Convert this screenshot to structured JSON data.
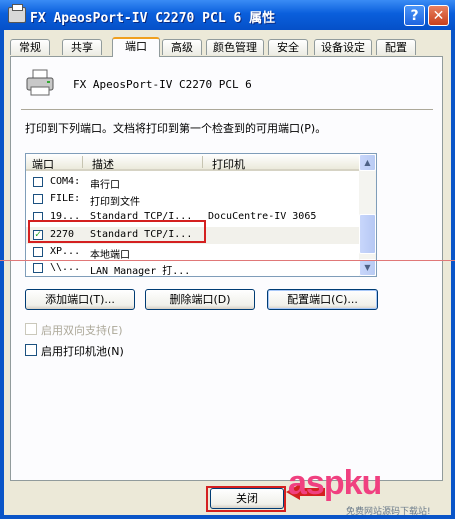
{
  "window": {
    "title": "FX ApeosPort-IV C2270 PCL 6 属性",
    "help_label": "?",
    "close_label": "✕"
  },
  "tabs": [
    {
      "label": "常规"
    },
    {
      "label": "共享"
    },
    {
      "label": "端口",
      "active": true
    },
    {
      "label": "高级"
    },
    {
      "label": "颜色管理"
    },
    {
      "label": "安全"
    },
    {
      "label": "设备设定"
    },
    {
      "label": "配置"
    }
  ],
  "printer_name": "FX ApeosPort-IV C2270 PCL 6",
  "instruction": "打印到下列端口。文档将打印到第一个检查到的可用端口(P)。",
  "port_list": {
    "columns": [
      "端口",
      "描述",
      "打印机"
    ],
    "rows": [
      {
        "checked": false,
        "port": "COM4:",
        "desc": "串行口",
        "printer": ""
      },
      {
        "checked": false,
        "port": "FILE:",
        "desc": "打印到文件",
        "printer": ""
      },
      {
        "checked": false,
        "port": "19...",
        "desc": "Standard TCP/I...",
        "printer": "DocuCentre-IV 3065"
      },
      {
        "checked": true,
        "port": "2270",
        "desc": "Standard TCP/I...",
        "printer": ""
      },
      {
        "checked": false,
        "port": "XP...",
        "desc": "本地端口",
        "printer": ""
      },
      {
        "checked": false,
        "port": "\\\\...",
        "desc": "LAN Manager 打...",
        "printer": ""
      }
    ],
    "scroll_up": "▲",
    "scroll_down": "▼"
  },
  "buttons": {
    "add_port": "添加端口(T)...",
    "delete_port": "删除端口(D)",
    "config_port": "配置端口(C)...",
    "close": "关闭"
  },
  "options": {
    "bidirectional": "启用双向支持(E)",
    "pooling": "启用打印机池(N)"
  },
  "watermark": {
    "text": "aspku",
    "sub": "免费网站源码下载站!"
  },
  "colors": {
    "titlebar": "#0a5fdc",
    "highlight": "#d42020"
  }
}
